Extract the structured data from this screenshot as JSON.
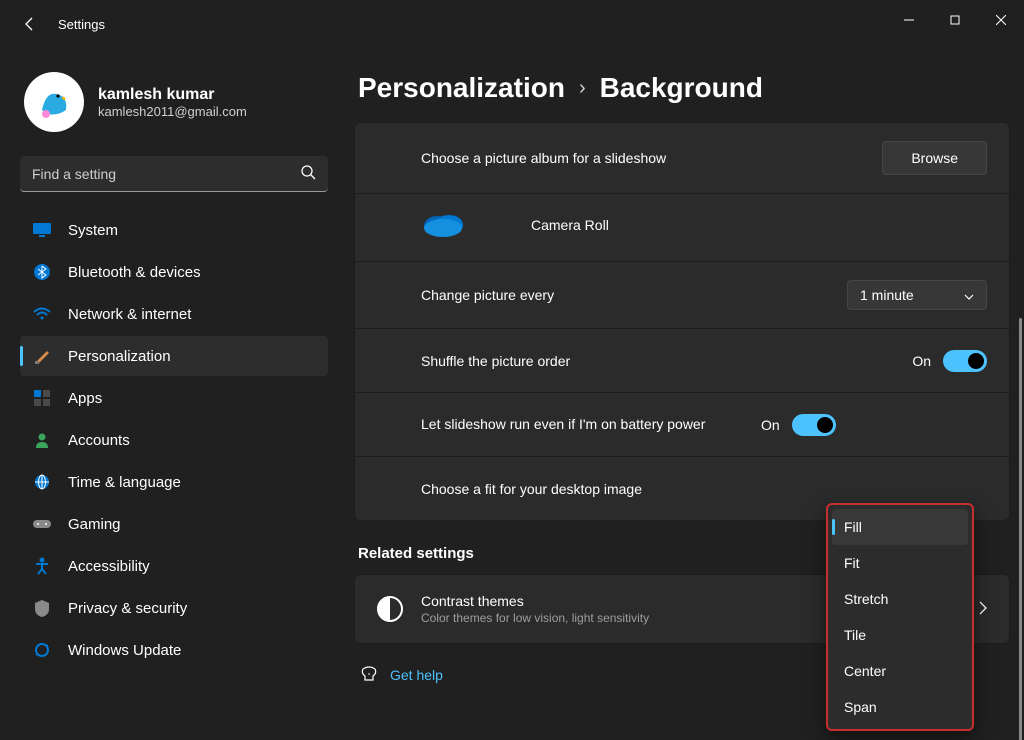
{
  "window": {
    "title": "Settings"
  },
  "profile": {
    "name": "kamlesh kumar",
    "email": "kamlesh2011@gmail.com"
  },
  "search": {
    "placeholder": "Find a setting"
  },
  "nav": [
    {
      "icon": "monitor",
      "label": "System"
    },
    {
      "icon": "bluetooth",
      "label": "Bluetooth & devices"
    },
    {
      "icon": "wifi",
      "label": "Network & internet"
    },
    {
      "icon": "brush",
      "label": "Personalization",
      "active": true
    },
    {
      "icon": "apps",
      "label": "Apps"
    },
    {
      "icon": "person",
      "label": "Accounts"
    },
    {
      "icon": "globe",
      "label": "Time & language"
    },
    {
      "icon": "gamepad",
      "label": "Gaming"
    },
    {
      "icon": "accessibility",
      "label": "Accessibility"
    },
    {
      "icon": "shield",
      "label": "Privacy & security"
    },
    {
      "icon": "sync",
      "label": "Windows Update"
    }
  ],
  "breadcrumb": {
    "parent": "Personalization",
    "current": "Background"
  },
  "rows": {
    "album_label": "Choose a picture album for a slideshow",
    "browse_btn": "Browse",
    "album_name": "Camera Roll",
    "interval_label": "Change picture every",
    "interval_value": "1 minute",
    "shuffle_label": "Shuffle the picture order",
    "shuffle_state": "On",
    "battery_label": "Let slideshow run even if I'm on battery power",
    "battery_state": "On",
    "fit_label": "Choose a fit for your desktop image"
  },
  "dropdown": {
    "options": [
      "Fill",
      "Fit",
      "Stretch",
      "Tile",
      "Center",
      "Span"
    ],
    "selected": "Fill"
  },
  "related": {
    "heading": "Related settings",
    "contrast_title": "Contrast themes",
    "contrast_sub": "Color themes for low vision, light sensitivity"
  },
  "help": {
    "label": "Get help"
  }
}
